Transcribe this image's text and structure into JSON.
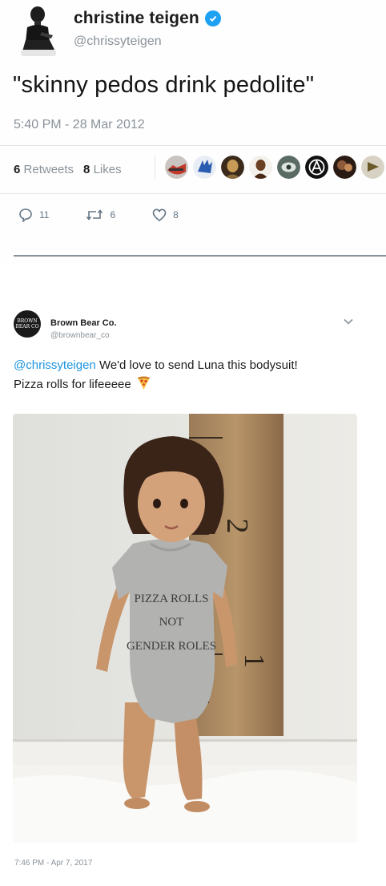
{
  "tweet1": {
    "name": "christine teigen",
    "handle": "@chrissyteigen",
    "text": "\"skinny pedos drink pedolite\"",
    "timestamp": "5:40 PM - 28 Mar 2012",
    "retweets_count": "6",
    "retweets_label": "Retweets",
    "likes_count": "8",
    "likes_label": "Likes",
    "reply_count": "11",
    "retweet_count": "6",
    "like_count": "8",
    "icons": [
      "verified-badge-icon",
      "reply-icon",
      "retweet-icon",
      "heart-icon"
    ],
    "colors": {
      "verified": "#1da1f2",
      "muted": "#8a9299"
    }
  },
  "tweet2": {
    "name": "Brown Bear Co.",
    "handle": "@brownbear_co",
    "logo_text": "BROWN BEAR CO",
    "mention": "@chrissyteigen",
    "text_after_mention": " We'd love to send Luna this bodysuit!",
    "text_line2": "Pizza rolls for lifeeeee",
    "timestamp": "7:46 PM - Apr 7, 2017",
    "photo": {
      "bodysuit_line1": "PIZZA ROLLS",
      "bodysuit_line2": "NOT",
      "bodysuit_line3": "GENDER ROLES",
      "growth_chart_marks": [
        "2",
        "1"
      ]
    },
    "icons": [
      "chevron-down-icon",
      "pizza-emoji-icon"
    ],
    "colors": {
      "link": "#1b95e0"
    }
  }
}
